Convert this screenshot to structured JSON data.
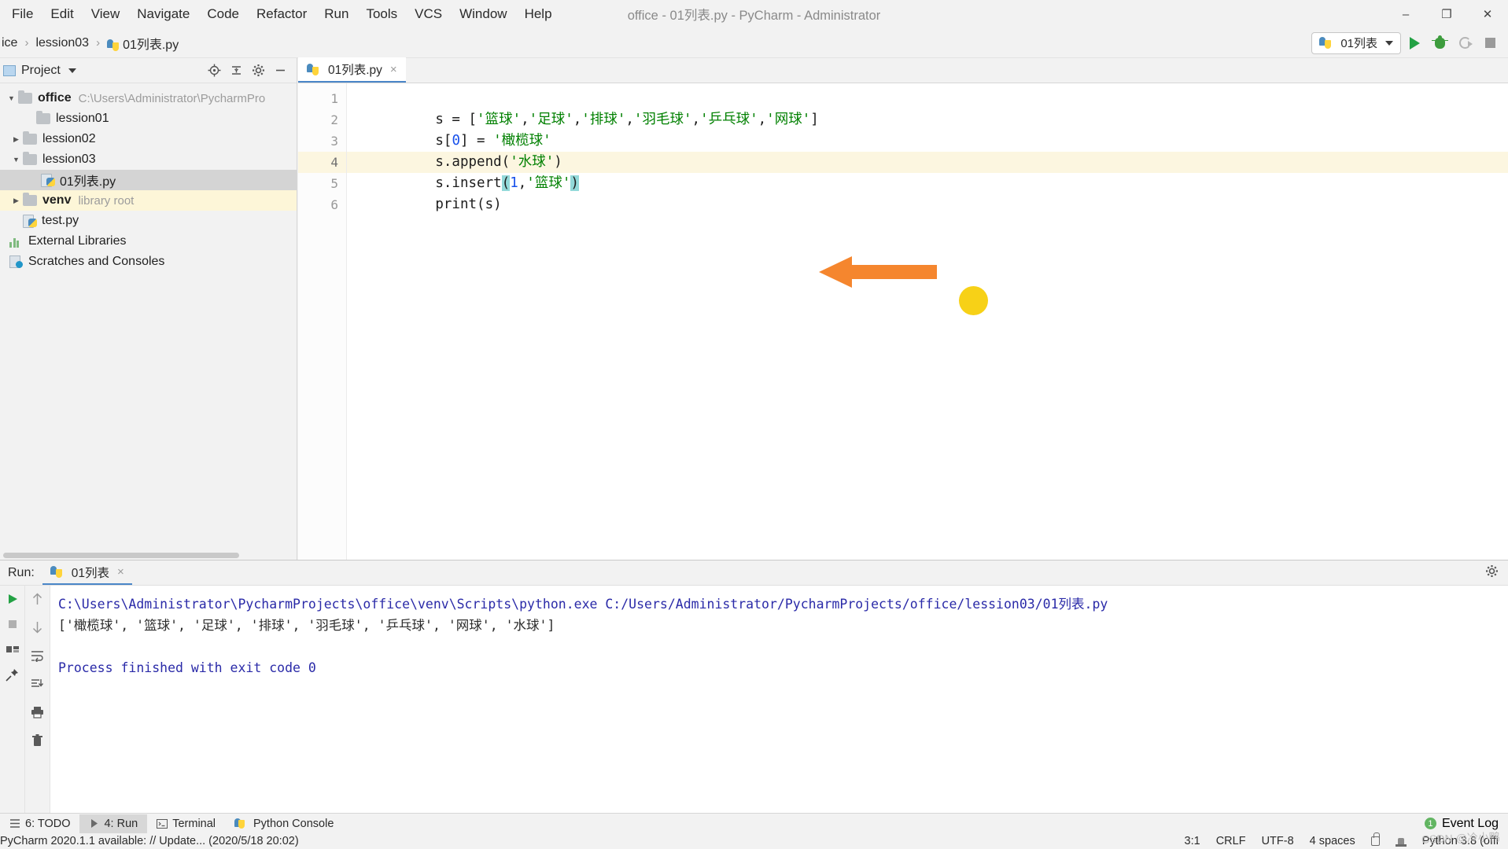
{
  "window": {
    "title": "office - 01列表.py - PyCharm - Administrator",
    "minimize": "–",
    "maximize": "❐",
    "close": "✕"
  },
  "menubar": {
    "items": [
      "File",
      "Edit",
      "View",
      "Navigate",
      "Code",
      "Refactor",
      "Run",
      "Tools",
      "VCS",
      "Window",
      "Help"
    ]
  },
  "navbar": {
    "breadcrumbs": [
      "ice",
      "lession03",
      "01列表.py"
    ],
    "separator": "›",
    "run_config": "01列表",
    "buttons": [
      "run-button",
      "debug-button",
      "coverage-button",
      "stop-button"
    ]
  },
  "project": {
    "panel_title": "Project",
    "tools": [
      "locate-icon",
      "collapse-all-icon",
      "settings-icon",
      "hide-icon"
    ],
    "tree": [
      {
        "label": "office",
        "sub": "C:\\Users\\Administrator\\PycharmPro",
        "arrow": "down",
        "icon": "folder",
        "bold": true,
        "state": "normal",
        "indent": 0
      },
      {
        "label": "lession01",
        "sub": "",
        "arrow": "none",
        "icon": "folder",
        "bold": false,
        "state": "normal",
        "indent": 1
      },
      {
        "label": "lession02",
        "sub": "",
        "arrow": "right",
        "icon": "folder",
        "bold": false,
        "state": "normal",
        "indent": 1
      },
      {
        "label": "lession03",
        "sub": "",
        "arrow": "down",
        "icon": "folder",
        "bold": false,
        "state": "normal",
        "indent": 1
      },
      {
        "label": "01列表.py",
        "sub": "",
        "arrow": "none",
        "icon": "python",
        "bold": false,
        "state": "selected",
        "indent": 2
      },
      {
        "label": "venv",
        "sub": "library root",
        "arrow": "right",
        "icon": "folder",
        "bold": false,
        "state": "highlight",
        "indent": 1
      },
      {
        "label": "test.py",
        "sub": "",
        "arrow": "none",
        "icon": "python",
        "bold": false,
        "state": "normal",
        "indent": 1
      },
      {
        "label": "External Libraries",
        "sub": "",
        "arrow": "none",
        "icon": "bars",
        "bold": false,
        "state": "normal",
        "indent": 0
      },
      {
        "label": "Scratches and Consoles",
        "sub": "",
        "arrow": "none",
        "icon": "scratch",
        "bold": false,
        "state": "normal",
        "indent": 0
      }
    ]
  },
  "editor": {
    "tab_label": "01列表.py",
    "tab_close": "×",
    "line_numbers": [
      "1",
      "2",
      "3",
      "4",
      "5",
      "6"
    ],
    "current_line": 4,
    "lines": [
      {
        "n": 1,
        "tokens": [
          {
            "t": "s = [",
            "c": "plain"
          },
          {
            "t": "'篮球'",
            "c": "str"
          },
          {
            "t": ",",
            "c": "plain"
          },
          {
            "t": "'足球'",
            "c": "str"
          },
          {
            "t": ",",
            "c": "plain"
          },
          {
            "t": "'排球'",
            "c": "str"
          },
          {
            "t": ",",
            "c": "plain"
          },
          {
            "t": "'羽毛球'",
            "c": "str"
          },
          {
            "t": ",",
            "c": "plain"
          },
          {
            "t": "'乒乓球'",
            "c": "str"
          },
          {
            "t": ",",
            "c": "plain"
          },
          {
            "t": "'网球'",
            "c": "str"
          },
          {
            "t": "]",
            "c": "plain"
          }
        ]
      },
      {
        "n": 2,
        "tokens": [
          {
            "t": "s[",
            "c": "plain"
          },
          {
            "t": "0",
            "c": "num"
          },
          {
            "t": "] = ",
            "c": "plain"
          },
          {
            "t": "'橄榄球'",
            "c": "str"
          }
        ]
      },
      {
        "n": 3,
        "tokens": [
          {
            "t": "s.append(",
            "c": "plain"
          },
          {
            "t": "'水球'",
            "c": "str"
          },
          {
            "t": ")",
            "c": "plain"
          }
        ]
      },
      {
        "n": 4,
        "tokens": [
          {
            "t": "s.insert",
            "c": "plain"
          },
          {
            "t": "(",
            "c": "brace-hl"
          },
          {
            "t": "1",
            "c": "num"
          },
          {
            "t": ",",
            "c": "plain"
          },
          {
            "t": "'篮球'",
            "c": "str"
          },
          {
            "t": ")",
            "c": "brace-hl"
          }
        ]
      },
      {
        "n": 5,
        "tokens": [
          {
            "t": "print(s)",
            "c": "plain"
          }
        ]
      },
      {
        "n": 6,
        "tokens": []
      }
    ],
    "annotations": {
      "arrow": "orange-left-arrow",
      "dot": "yellow-dot"
    }
  },
  "run_panel": {
    "label": "Run:",
    "tab": "01列表",
    "tab_close": "×",
    "left_tools": [
      "rerun-icon",
      "stop-icon",
      "layout-icon",
      "pin-icon"
    ],
    "right_tools": [
      "up-icon",
      "down-icon",
      "soft-wrap-icon",
      "scroll-to-end-icon",
      "print-icon",
      "trash-icon"
    ],
    "settings": "gear-icon",
    "console": [
      {
        "text": "C:\\Users\\Administrator\\PycharmProjects\\office\\venv\\Scripts\\python.exe C:/Users/Administrator/PycharmProjects/office/lession03/01列表.py",
        "style": "cmd"
      },
      {
        "text": "['橄榄球', '篮球', '足球', '排球', '羽毛球', '乒乓球', '网球', '水球']",
        "style": "out"
      },
      {
        "text": "",
        "style": "blank"
      },
      {
        "text": "Process finished with exit code 0",
        "style": "cmd"
      }
    ]
  },
  "toolwindow_bar": {
    "items": [
      {
        "label": "6: TODO",
        "icon": "todo-icon",
        "active": false
      },
      {
        "label": "4: Run",
        "icon": "run-icon",
        "active": true
      },
      {
        "label": "Terminal",
        "icon": "terminal-icon",
        "active": false
      },
      {
        "label": "Python Console",
        "icon": "python-icon",
        "active": false
      }
    ],
    "event_log": "Event Log",
    "event_count": "1"
  },
  "statusbar": {
    "message": "PyCharm 2020.1.1 available: // Update... (2020/5/18 20:02)",
    "caret": "3:1",
    "line_sep": "CRLF",
    "encoding": "UTF-8",
    "indent": "4 spaces",
    "interpreter": "Python 3.8 (offi",
    "watermark": "CSDN @冷小鸭"
  }
}
